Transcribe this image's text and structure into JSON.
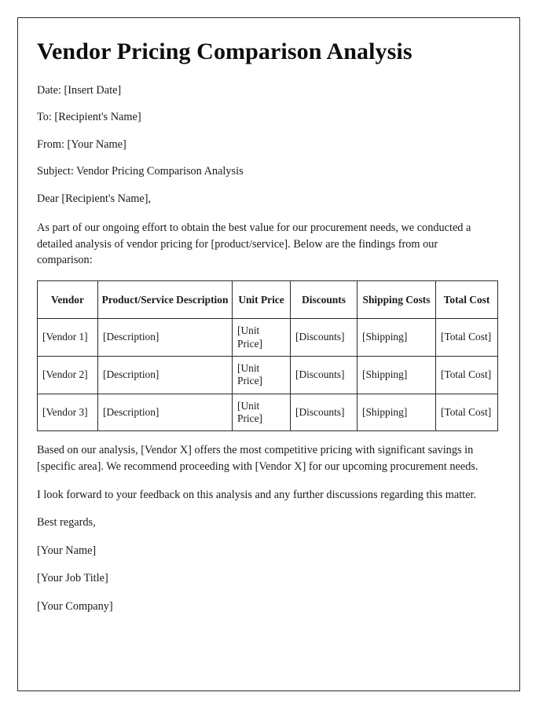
{
  "document": {
    "title": "Vendor Pricing Comparison Analysis",
    "meta": {
      "date_line": "Date: [Insert Date]",
      "to_line": "To: [Recipient's Name]",
      "from_line": "From: [Your Name]",
      "subject_line": "Subject: Vendor Pricing Comparison Analysis"
    },
    "salutation": "Dear [Recipient's Name],",
    "intro_paragraph": "As part of our ongoing effort to obtain the best value for our procurement needs, we conducted a detailed analysis of vendor pricing for [product/service]. Below are the findings from our comparison:",
    "conclusion_paragraph": "Based on our analysis, [Vendor X] offers the most competitive pricing with significant savings in [specific area]. We recommend proceeding with [Vendor X] for our upcoming procurement needs.",
    "followup_paragraph": "I look forward to your feedback on this analysis and any further discussions regarding this matter.",
    "closing": "Best regards,",
    "signature": {
      "name": "[Your Name]",
      "job_title": "[Your Job Title]",
      "company": "[Your Company]"
    }
  },
  "table": {
    "headers": [
      "Vendor",
      "Product/Service Description",
      "Unit Price",
      "Discounts",
      "Shipping Costs",
      "Total Cost"
    ],
    "rows": [
      {
        "vendor": "[Vendor 1]",
        "description": "[Description]",
        "unit_price": "[Unit Price]",
        "discounts": "[Discounts]",
        "shipping": "[Shipping]",
        "total": "[Total Cost]"
      },
      {
        "vendor": "[Vendor 2]",
        "description": "[Description]",
        "unit_price": "[Unit Price]",
        "discounts": "[Discounts]",
        "shipping": "[Shipping]",
        "total": "[Total Cost]"
      },
      {
        "vendor": "[Vendor 3]",
        "description": "[Description]",
        "unit_price": "[Unit Price]",
        "discounts": "[Discounts]",
        "shipping": "[Shipping]",
        "total": "[Total Cost]"
      }
    ]
  },
  "style": {
    "page_border_color": "#2b2b2b",
    "text_color": "#1a1a1a",
    "background_color": "#ffffff"
  }
}
